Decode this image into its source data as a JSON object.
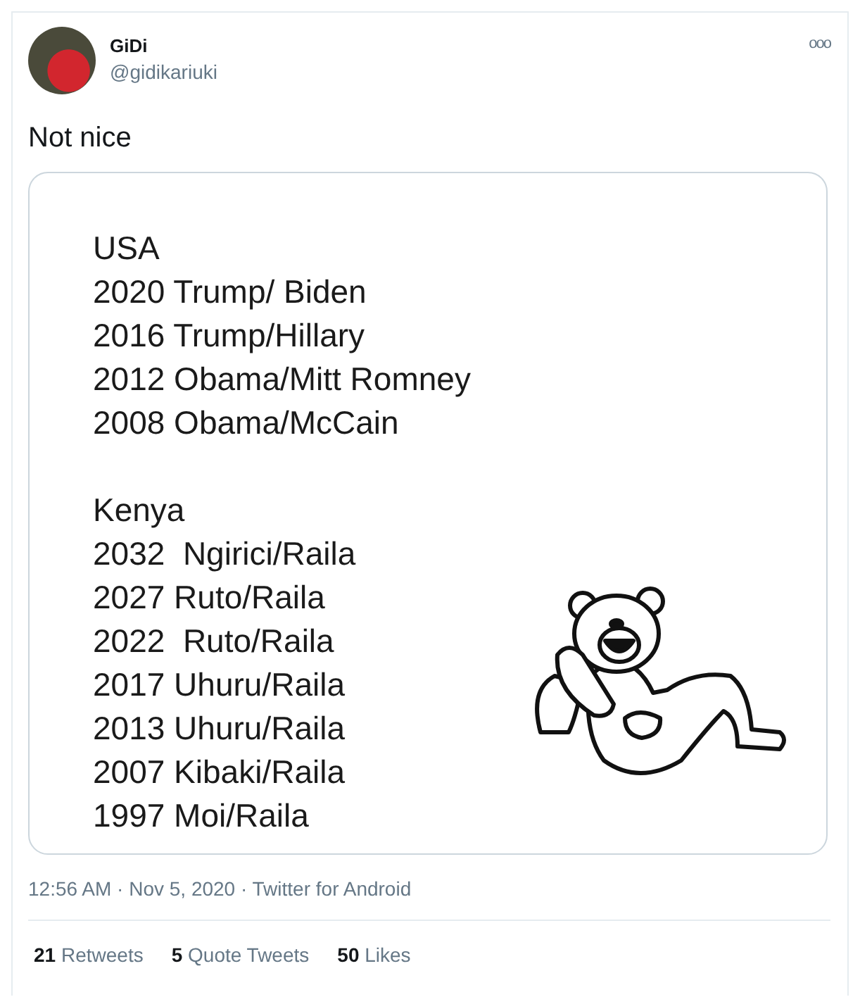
{
  "author": {
    "name": "GiDi",
    "handle": "@gidikariuki"
  },
  "more_icon": "ooo",
  "text": "Not nice",
  "media": {
    "sections": [
      {
        "heading": "USA",
        "lines": [
          "2020 Trump/ Biden",
          "2016 Trump/Hillary",
          "2012 Obama/Mitt Romney",
          "2008 Obama/McCain"
        ]
      },
      {
        "heading": "Kenya",
        "lines": [
          "2032  Ngirici/Raila",
          "2027 Ruto/Raila",
          "2022  Ruto/Raila",
          "2017 Uhuru/Raila",
          "2013 Uhuru/Raila",
          "2007 Kibaki/Raila",
          "1997 Moi/Raila"
        ]
      }
    ]
  },
  "meta": "12:56 AM · Nov 5, 2020 · Twitter for Android",
  "stats": [
    {
      "count": "21",
      "label": "Retweets"
    },
    {
      "count": "5",
      "label": "Quote Tweets"
    },
    {
      "count": "50",
      "label": "Likes"
    }
  ]
}
